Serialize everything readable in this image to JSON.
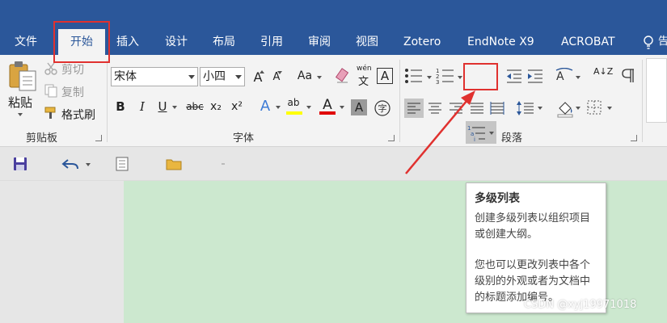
{
  "tabs": [
    {
      "key": "file",
      "label": "文件"
    },
    {
      "key": "home",
      "label": "开始"
    },
    {
      "key": "insert",
      "label": "插入"
    },
    {
      "key": "design",
      "label": "设计"
    },
    {
      "key": "layout",
      "label": "布局"
    },
    {
      "key": "references",
      "label": "引用"
    },
    {
      "key": "review",
      "label": "审阅"
    },
    {
      "key": "view",
      "label": "视图"
    },
    {
      "key": "zotero",
      "label": "Zotero"
    },
    {
      "key": "endnote",
      "label": "EndNote X9"
    },
    {
      "key": "acrobat",
      "label": "ACROBAT"
    }
  ],
  "help_label": "告",
  "clipboard": {
    "paste": "粘贴",
    "cut": "剪切",
    "copy": "复制",
    "format_painter": "格式刷",
    "group_label": "剪贴板"
  },
  "font": {
    "font_name": "宋体",
    "font_size": "小四",
    "phonetic_top": "wén",
    "phonetic_bottom": "文",
    "grow_label": "A",
    "shrink_label": "A",
    "change_case": "Aa",
    "border_char": "A",
    "bold": "B",
    "italic": "I",
    "underline": "U",
    "strike": "abc",
    "subscript": "x₂",
    "superscript": "x²",
    "text_effect": "A",
    "highlight": "ab",
    "font_color": "A",
    "char_shading": "A",
    "group_label": "字体"
  },
  "paragraph": {
    "group_label": "段落",
    "sort_label": "A↓Z"
  },
  "tooltip": {
    "title": "多级列表",
    "line1": "创建多级列表以组织项目或创建大纲。",
    "line2": "您也可以更改列表中各个级别的外观或者为文档中的标题添加编号。"
  },
  "watermark": "CSDN @xyj19971018",
  "colors": {
    "ribbon_blue": "#2b579a",
    "highlight_red": "#e0312f",
    "doc_green": "#cce8cf",
    "highlight_yellow": "#ffff00",
    "font_red": "#e00000"
  }
}
